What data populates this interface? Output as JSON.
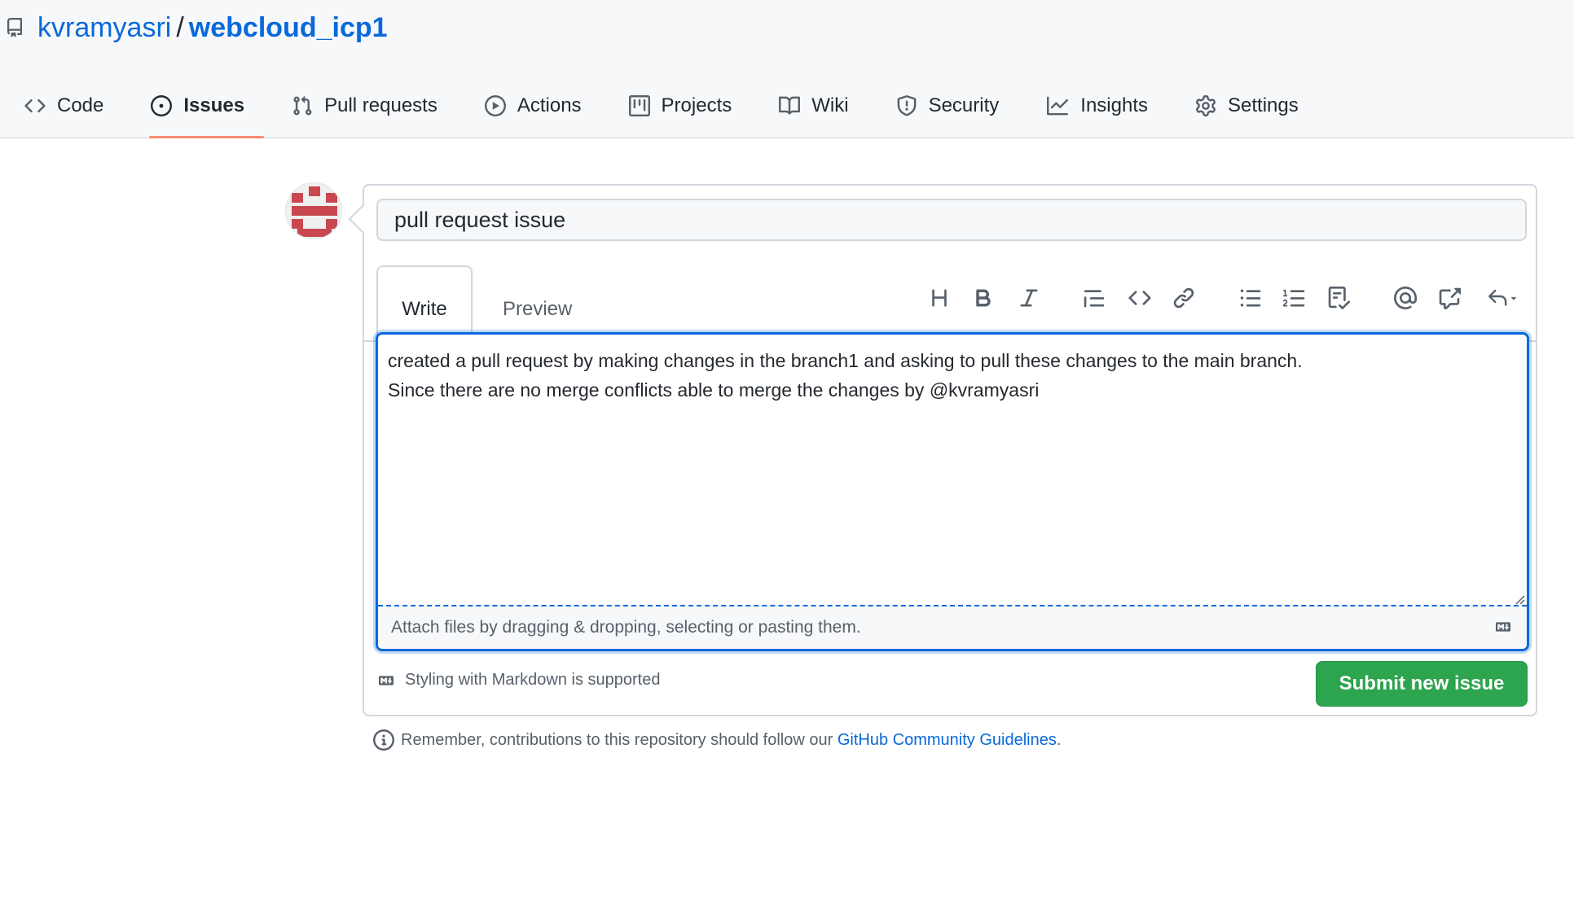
{
  "repo": {
    "owner": "kvramyasri",
    "separator": "/",
    "name": "webcloud_icp1",
    "icon": "repo-icon"
  },
  "tabs": [
    {
      "label": "Code",
      "icon": "code-icon",
      "active": false
    },
    {
      "label": "Issues",
      "icon": "issue-opened-icon",
      "active": true
    },
    {
      "label": "Pull requests",
      "icon": "git-pull-request-icon",
      "active": false
    },
    {
      "label": "Actions",
      "icon": "play-icon",
      "active": false
    },
    {
      "label": "Projects",
      "icon": "table-icon",
      "active": false
    },
    {
      "label": "Wiki",
      "icon": "book-icon",
      "active": false
    },
    {
      "label": "Security",
      "icon": "shield-icon",
      "active": false
    },
    {
      "label": "Insights",
      "icon": "graph-icon",
      "active": false
    },
    {
      "label": "Settings",
      "icon": "gear-icon",
      "active": false
    }
  ],
  "issue_form": {
    "title_value": "pull request issue",
    "write_tab": "Write",
    "preview_tab": "Preview",
    "toolbar": [
      "heading-icon",
      "bold-icon",
      "italic-icon",
      "quote-icon",
      "code-icon",
      "link-icon",
      "unordered-list-icon",
      "ordered-list-icon",
      "tasklist-icon",
      "mention-icon",
      "cross-reference-icon",
      "reply-icon"
    ],
    "body_text": "created a pull request by making changes in the branch1 and asking to pull these changes to the main branch.\nSince there are no merge conflicts able to merge the changes by @kvramyasri",
    "attach_text": "Attach files by dragging & dropping, selecting or pasting them.",
    "markdown_note": "Styling with Markdown is supported",
    "submit_label": "Submit new issue"
  },
  "reminder": {
    "text": "Remember, contributions to this repository should follow our",
    "link": "GitHub Community Guidelines",
    "end": "."
  },
  "colors": {
    "link": "#0969da",
    "submit": "#2da44e",
    "active_tab_underline": "#fd8c73",
    "avatar": "#c9474f"
  }
}
